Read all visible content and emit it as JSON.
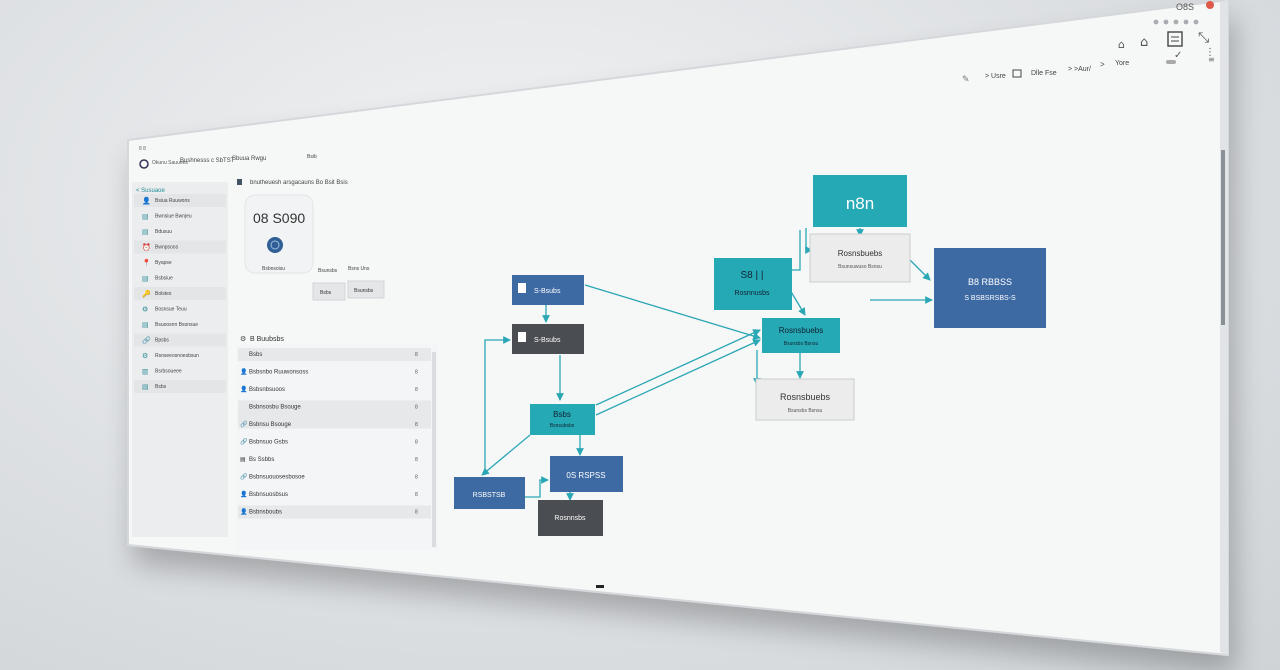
{
  "window": {
    "controls_label": "O8S"
  },
  "topbar": {
    "left_title": "Bushnesss c SbTST",
    "left_sub": "Sbuua Rwgu",
    "mid_label": "Bsib",
    "breadcrumb": "bnutheuesh arsgacauns  Bo  Bsit Bsis",
    "right_items": [
      "> Usre",
      "Dlle Fse",
      "> >Aur/",
      ">",
      "Yore"
    ]
  },
  "sidebar": {
    "brand": "Okunu Sauuoes",
    "section": "< Susuaoe",
    "items": [
      {
        "icon": "user-icon",
        "label": "Bsiua Ruuwons"
      },
      {
        "icon": "doc-icon",
        "label": "Bwnsiue Bwnjeu"
      },
      {
        "icon": "doc-icon",
        "label": "Bdusuu"
      },
      {
        "icon": "bell-icon",
        "label": "Bwnpsoos"
      },
      {
        "icon": "pin-icon",
        "label": "Byapse"
      },
      {
        "icon": "doc-icon",
        "label": "Bsbsiue"
      },
      {
        "icon": "key-icon",
        "label": "Bolstes"
      },
      {
        "icon": "gear-icon",
        "label": "Bosnsue Teuu"
      },
      {
        "icon": "doc-icon",
        "label": "Bsuoosnn Bsonsue"
      },
      {
        "icon": "link-icon",
        "label": "Bpsbs"
      },
      {
        "icon": "gear-icon",
        "label": "Rsoseeosnoesbsun"
      },
      {
        "icon": "chart-icon",
        "label": "Bsrbsoueee"
      },
      {
        "icon": "doc-icon",
        "label": "Bsbs"
      }
    ]
  },
  "profile": {
    "title": "08 S090",
    "caption": "Bsbnsoisu",
    "tags": [
      "Bsunsbs",
      "Bsns Uns"
    ],
    "buttons": [
      "Bsbs",
      "Bsunsbs"
    ]
  },
  "list": {
    "heading": "B Buubsbs",
    "rows": [
      {
        "label": "Bsbs",
        "value": "8",
        "icon": ""
      },
      {
        "label": "Bsbsnbo Ruuwonsoss",
        "value": "8",
        "icon": "user-icon"
      },
      {
        "label": "Bsbsnbsuoos",
        "value": "8",
        "icon": "user-icon"
      },
      {
        "label": "Bsbnsosbu Bsouge",
        "value": "8",
        "icon": ""
      },
      {
        "label": "Bsbnsu Bsouge",
        "value": "8",
        "icon": "link-icon"
      },
      {
        "label": "Bsbnsuo Gsbs",
        "value": "8",
        "icon": "link-icon"
      },
      {
        "label": "Bs Ssbbs",
        "value": "8",
        "icon": "doc-icon"
      },
      {
        "label": "Bsbnsuouosesbosoe",
        "value": "8",
        "icon": "link-icon"
      },
      {
        "label": "Bsbnsuosbsus",
        "value": "8",
        "icon": "user-icon"
      },
      {
        "label": "Bsbnsboubs",
        "value": "8",
        "icon": "user-icon"
      }
    ]
  },
  "workflow": {
    "nodes": [
      {
        "id": "n8n",
        "label": "n8n",
        "sub": ""
      },
      {
        "id": "top-grey",
        "label": "Rosnsbuebs",
        "sub": "Bsunsuwuso Bsnsu"
      },
      {
        "id": "teal-top",
        "label": "S8 | |",
        "sub": "Rosnnusbs"
      },
      {
        "id": "teal-mid",
        "label": "Rosnsbuebs",
        "sub": "Bsunsbs Bsnsu"
      },
      {
        "id": "grey-mid",
        "label": "Rosnsbuebs",
        "sub": "Bsunsbs Bsnsu"
      },
      {
        "id": "blue-right",
        "label": "B8 RBBSS",
        "sub": "S BSBSRSBS-S"
      },
      {
        "id": "blue-a",
        "label": "S-Bsubs",
        "sub": ""
      },
      {
        "id": "dark-b",
        "label": "S-Bsubs",
        "sub": ""
      },
      {
        "id": "teal-c",
        "label": "Bsbs",
        "sub": "Bsnsubsbs"
      },
      {
        "id": "blue-d",
        "label": "0S RSPSS",
        "sub": ""
      },
      {
        "id": "blue-e",
        "label": "RSBSTSB",
        "sub": ""
      },
      {
        "id": "dark-f",
        "label": "Rosnnsbs",
        "sub": ""
      }
    ]
  },
  "colors": {
    "teal": "#25a9b4",
    "blue": "#3d6aa3",
    "dark": "#4a4d51",
    "grey_node": "#ececec",
    "edge": "#2aa7b4"
  }
}
